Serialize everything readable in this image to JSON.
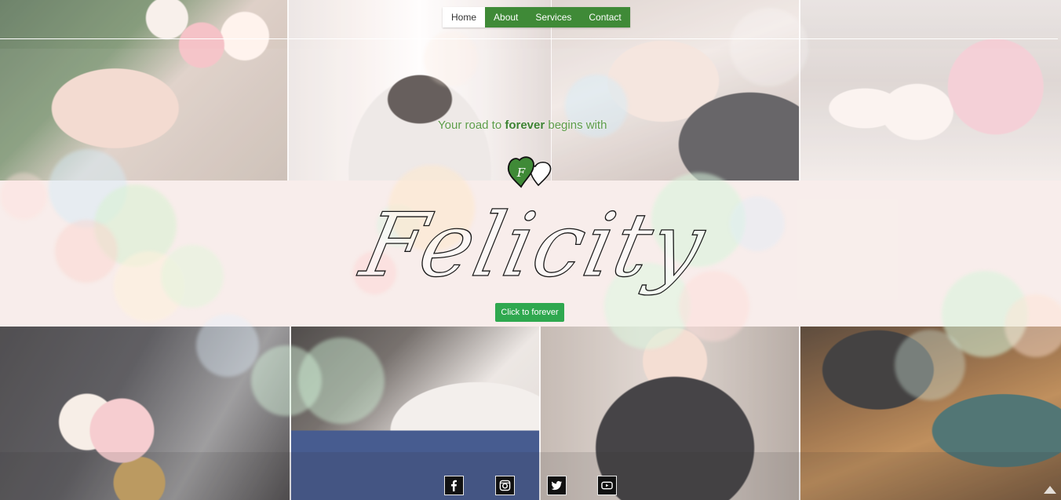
{
  "nav": {
    "items": [
      {
        "label": "Home",
        "active": true
      },
      {
        "label": "About",
        "active": false
      },
      {
        "label": "Services",
        "active": false
      },
      {
        "label": "Contact",
        "active": false
      }
    ]
  },
  "hero": {
    "tagline_prefix": "Your road to ",
    "tagline_emphasis": "forever",
    "tagline_suffix": " begins with",
    "heart_letter": "F",
    "brand": "Felicity",
    "cta_label": "Click to forever"
  },
  "social": [
    {
      "name": "facebook-icon",
      "glyph": "f"
    },
    {
      "name": "instagram-icon",
      "glyph": "camera"
    },
    {
      "name": "twitter-icon",
      "glyph": "bird"
    },
    {
      "name": "youtube-icon",
      "glyph": "play"
    }
  ],
  "colors": {
    "accent_green": "#3f8a37",
    "cta_green": "#2fa84f",
    "tagline_green": "#5d9d49"
  }
}
